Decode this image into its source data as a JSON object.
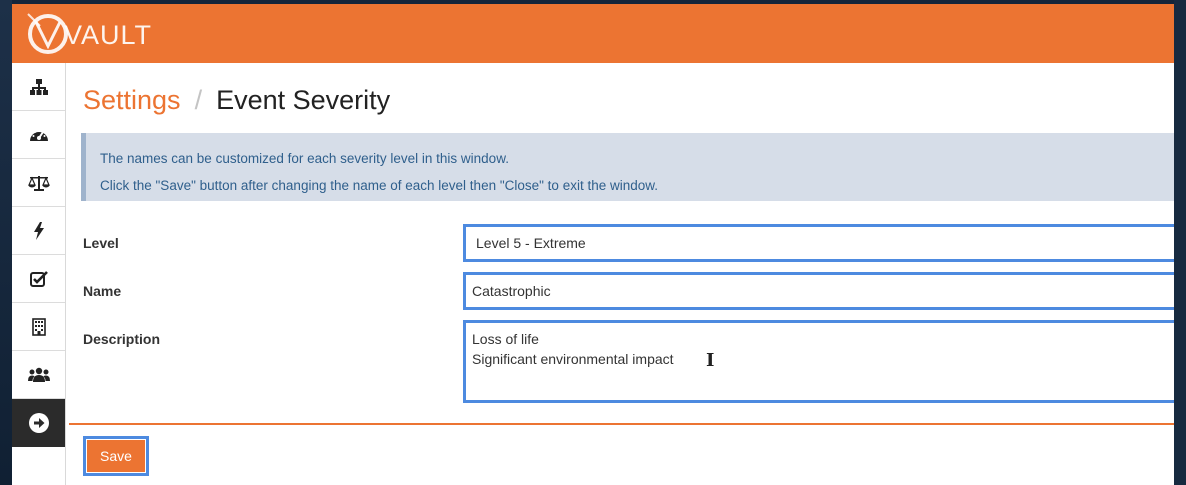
{
  "header": {
    "logo_text": "VAULT",
    "brand_color": "#ec7432"
  },
  "sidebar": {
    "items": [
      {
        "icon": "sitemap-icon",
        "active": false
      },
      {
        "icon": "dashboard-gauge-icon",
        "active": false
      },
      {
        "icon": "balance-scale-icon",
        "active": false
      },
      {
        "icon": "bolt-icon",
        "active": false
      },
      {
        "icon": "check-square-icon",
        "active": false
      },
      {
        "icon": "building-icon",
        "active": false
      },
      {
        "icon": "users-icon",
        "active": false
      },
      {
        "icon": "arrow-circle-right-icon",
        "active": true
      }
    ]
  },
  "breadcrumb": {
    "parent": "Settings",
    "separator": "/",
    "current": "Event Severity"
  },
  "info": {
    "line1": "The names can be customized for each severity level in this window.",
    "line2": "Click the \"Save\" button after changing the name of each level then \"Close\" to exit the window."
  },
  "form": {
    "level_label": "Level",
    "level_value": "Level 5 - Extreme",
    "name_label": "Name",
    "name_value": "Catastrophic",
    "description_label": "Description",
    "description_lines": [
      "Loss of life",
      "Significant environmental impact"
    ]
  },
  "actions": {
    "save_label": "Save"
  },
  "colors": {
    "accent": "#ec7432",
    "focus_border": "#4d8ae0",
    "info_bg": "#d6dde8",
    "info_text": "#2f5f8c"
  }
}
